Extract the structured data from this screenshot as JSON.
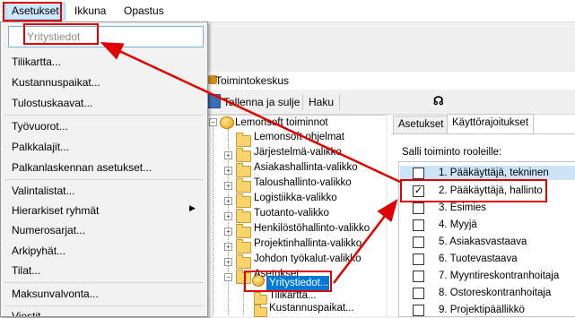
{
  "menubar": {
    "items": [
      "Asetukset",
      "Ikkuna",
      "Opastus"
    ]
  },
  "dropdown": {
    "search_placeholder": "Yritystiedot",
    "items": [
      "Tilikartta...",
      "Kustannuspaikat...",
      "Tulostuskaavat...",
      "Työvuorot...",
      "Palkkalajit...",
      "Palkanlaskennan asetukset...",
      "Valintalistat...",
      "Hierarkiset ryhmät",
      "Numerosarjat...",
      "Arkipyhät...",
      "Tilat...",
      "Maksunvalvonta...",
      "Viestit..."
    ]
  },
  "window": {
    "title": "Toimintokeskus",
    "toolbar": {
      "save_close": "Tallenna ja sulje",
      "search": "Haku"
    }
  },
  "tree": {
    "root": "Lemonsoft toiminnot",
    "items": [
      "Lemonsoft-ohjelmat",
      "Järjestelmä-valikko",
      "Asiakashallinta-valikko",
      "Taloushallinto-valikko",
      "Logistiikka-valikko",
      "Tuotanto-valikko",
      "Henkilöstöhallinto-valikko",
      "Projektinhallinta-valikko",
      "Johdon työkalut-valikko",
      "Asetukset"
    ],
    "children": [
      "Yritystiedot...",
      "Tilikartta...",
      "Kustannuspaikat..."
    ]
  },
  "tabs": [
    "Asetukset",
    "Käyttörajoitukset"
  ],
  "roles": {
    "heading": "Salli toiminto rooleille:",
    "items": [
      {
        "label": "1. Pääkäyttäjä, tekninen",
        "checked": false
      },
      {
        "label": "2. Pääkäyttäjä, hallinto",
        "checked": true
      },
      {
        "label": "3. Esimies",
        "checked": false
      },
      {
        "label": "4. Myyjä",
        "checked": false
      },
      {
        "label": "5. Asiakasvastaava",
        "checked": false
      },
      {
        "label": "6. Tuotevastaava",
        "checked": false
      },
      {
        "label": "7. Myyntireskontranhoitaja",
        "checked": false
      },
      {
        "label": "8. Ostoreskontranhoitaja",
        "checked": false
      },
      {
        "label": "9. Projektipäällikkö",
        "checked": false
      }
    ]
  },
  "colors": {
    "highlight": "#e00000",
    "selection": "#0078d7",
    "menu_hover": "#cce8ff"
  }
}
